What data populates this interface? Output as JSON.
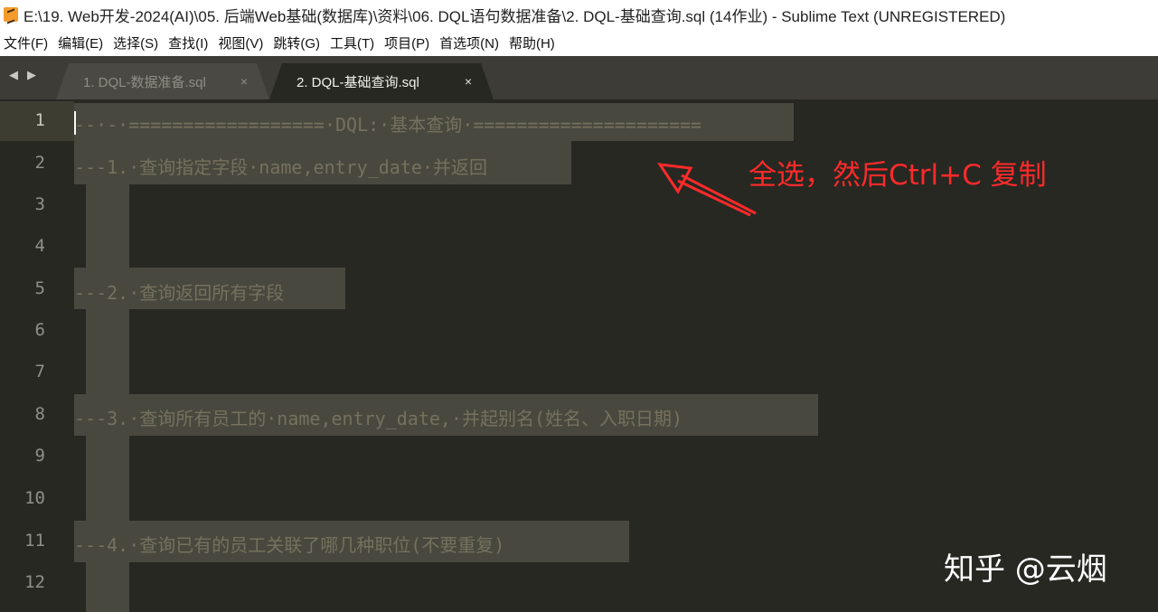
{
  "window": {
    "title": "E:\\19. Web开发-2024(AI)\\05. 后端Web基础(数据库)\\资料\\06. DQL语句数据准备\\2. DQL-基础查询.sql (14作业) - Sublime Text (UNREGISTERED)"
  },
  "menu": [
    {
      "label": "文件(F)"
    },
    {
      "label": "编辑(E)"
    },
    {
      "label": "选择(S)"
    },
    {
      "label": "查找(I)"
    },
    {
      "label": "视图(V)"
    },
    {
      "label": "跳转(G)"
    },
    {
      "label": "工具(T)"
    },
    {
      "label": "项目(P)"
    },
    {
      "label": "首选项(N)"
    },
    {
      "label": "帮助(H)"
    }
  ],
  "tabs": [
    {
      "label": "1. DQL-数据准备.sql",
      "close": "×",
      "active": false
    },
    {
      "label": "2. DQL-基础查询.sql",
      "close": "×",
      "active": true
    }
  ],
  "tab_nav": {
    "prev": "◀",
    "next": "▶"
  },
  "editor": {
    "line_numbers": [
      "1",
      "2",
      "3",
      "4",
      "5",
      "6",
      "7",
      "8",
      "9",
      "10",
      "11",
      "12"
    ],
    "lines": [
      "--·-·==================·DQL:·基本查询·=====================",
      "---1.·查询指定字段·name,entry_date·并返回",
      "",
      "",
      "---2.·查询返回所有字段",
      "",
      "",
      "---3.·查询所有员工的·name,entry_date,·并起别名(姓名、入职日期)",
      "",
      "",
      "---4.·查询已有的员工关联了哪几种职位(不要重复)",
      ""
    ]
  },
  "annotation": {
    "text": "全选，然后Ctrl+C 复制",
    "color": "#ff2a2a"
  },
  "watermark": {
    "text": "知乎 @云烟"
  },
  "colors": {
    "editor_bg": "#272822",
    "selection": "#49483e",
    "comment": "#75715e",
    "line_number": "#8f908a"
  }
}
